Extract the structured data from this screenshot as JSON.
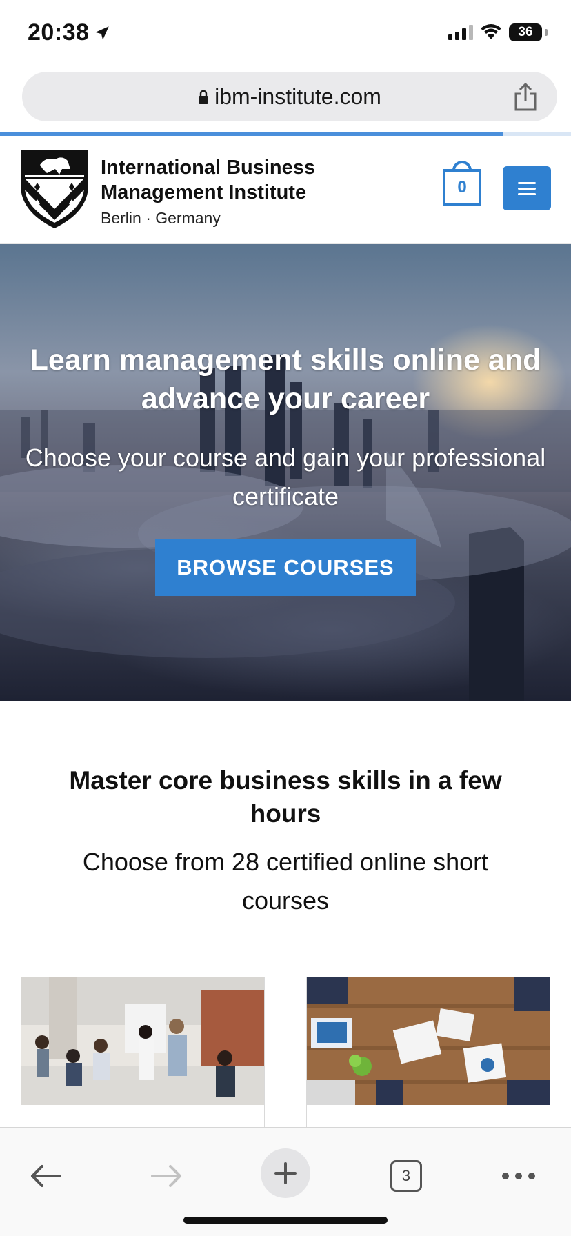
{
  "status_bar": {
    "time": "20:38",
    "battery": "36",
    "icons": [
      "location-arrow-icon",
      "signal-icon",
      "wifi-icon",
      "battery-icon"
    ]
  },
  "browser": {
    "url": "ibm-institute.com",
    "load_progress": 0.88,
    "icons": [
      "lock-icon",
      "share-icon"
    ]
  },
  "header": {
    "brand_line1": "International Business",
    "brand_line2": "Management Institute",
    "brand_line3": "Berlin · Germany",
    "cart_count": "0",
    "accent_color": "#2f80d0"
  },
  "hero": {
    "title": "Learn management skills online and advance your career",
    "subtitle": "Choose your course and gain your professional certificate",
    "button": "BROWSE COURSES"
  },
  "intro": {
    "title": "Master core business skills in a few hours",
    "subtitle": "Choose from 28 certified online short courses"
  },
  "toolbar": {
    "tab_count": "3",
    "icons": [
      "back-arrow-icon",
      "forward-arrow-icon",
      "plus-icon",
      "tabs-icon",
      "more-icon"
    ]
  }
}
